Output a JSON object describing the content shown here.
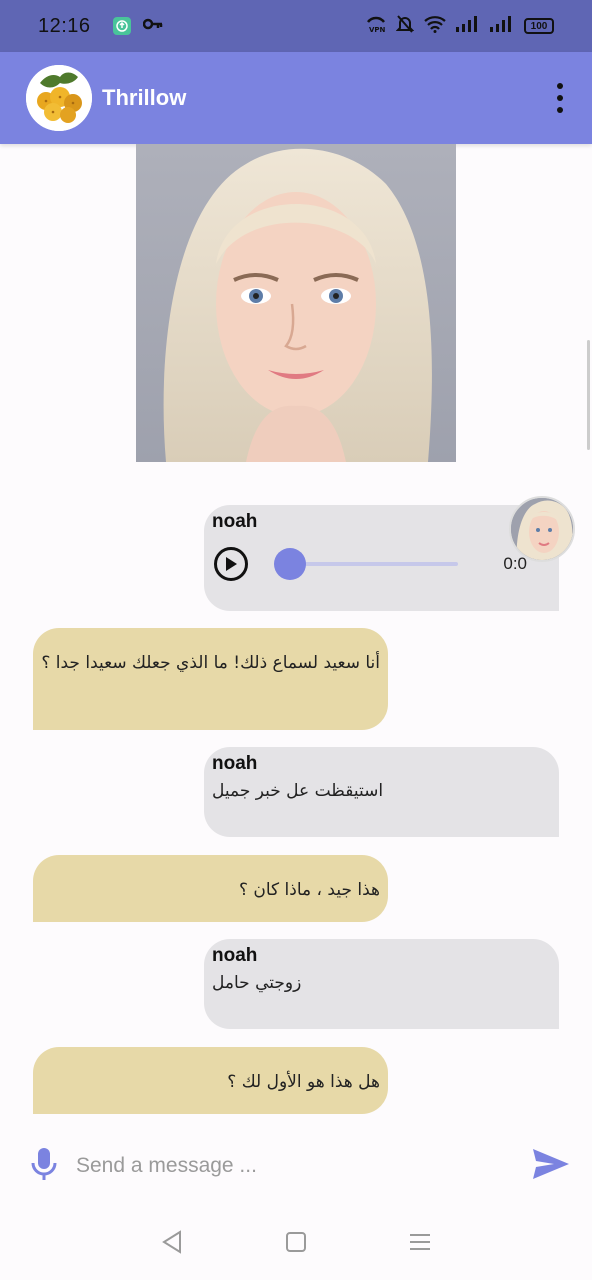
{
  "status_bar": {
    "time": "12:16",
    "battery": "100"
  },
  "app_bar": {
    "title": "Thrillow"
  },
  "messages": [
    {
      "sender": "noah",
      "type": "audio",
      "duration": "0:0",
      "progress": 0
    },
    {
      "type": "bot",
      "text": "أنا سعيد لسماع ذلك! ما الذي جعلك سعيدا جدا ؟"
    },
    {
      "sender": "noah",
      "type": "text",
      "text": "استيقظت عل خبر جميل"
    },
    {
      "type": "bot",
      "text": "هذا جيد ، ماذا كان ؟"
    },
    {
      "sender": "noah",
      "type": "text",
      "text": "زوجتي حامل"
    },
    {
      "type": "bot",
      "text": "هل هذا هو الأول لك ؟"
    }
  ],
  "composer": {
    "placeholder": "Send a message ..."
  },
  "colors": {
    "status_bar": "#5f66b4",
    "app_bar": "#7b83e0",
    "accent": "#7b83e0",
    "user_bubble": "#e4e3e6",
    "bot_bubble": "#e7d9a8"
  },
  "icons": {
    "menu": "more-vert-icon",
    "mic": "mic-icon",
    "send": "send-icon",
    "play": "play-icon",
    "back": "back-triangle-icon",
    "home": "home-square-icon",
    "recents": "menu-lines-icon"
  }
}
